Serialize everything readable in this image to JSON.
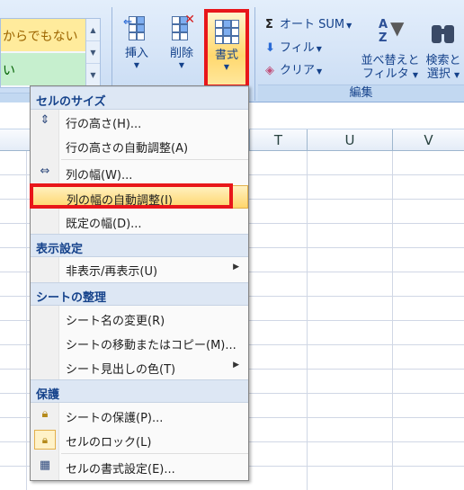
{
  "ribbon": {
    "styles_group": {
      "style1": "からでもない",
      "style2": "い"
    },
    "cells_group": {
      "insert_label": "挿入",
      "delete_label": "削除",
      "format_label": "書式"
    },
    "edit_group": {
      "autosum_label": "オート SUM",
      "fill_label": "フィル",
      "clear_label": "クリア",
      "sort_line1": "並べ替えと",
      "sort_line2": "フィルタ",
      "find_line1": "検索と",
      "find_line2": "選択",
      "group_title": "編集"
    }
  },
  "sheet": {
    "columns": [
      "T",
      "U",
      "V"
    ]
  },
  "menu": {
    "sections": {
      "cell_size": "セルのサイズ",
      "visibility": "表示設定",
      "organize": "シートの整理",
      "protection": "保護"
    },
    "items": {
      "row_height": "行の高さ(H)...",
      "autofit_row": "行の高さの自動調整(A)",
      "col_width": "列の幅(W)...",
      "autofit_col": "列の幅の自動調整(I)",
      "default_width": "既定の幅(D)...",
      "hide_unhide": "非表示/再表示(U)",
      "rename_sheet": "シート名の変更(R)",
      "move_copy_sheet": "シートの移動またはコピー(M)...",
      "tab_color": "シート見出しの色(T)",
      "protect_sheet": "シートの保護(P)...",
      "lock_cell": "セルのロック(L)",
      "format_cells": "セルの書式設定(E)..."
    }
  },
  "colors": {
    "highlight_red": "#e8161a",
    "hover_orange": "#ffd66b",
    "ribbon_blue": "#15428b"
  }
}
